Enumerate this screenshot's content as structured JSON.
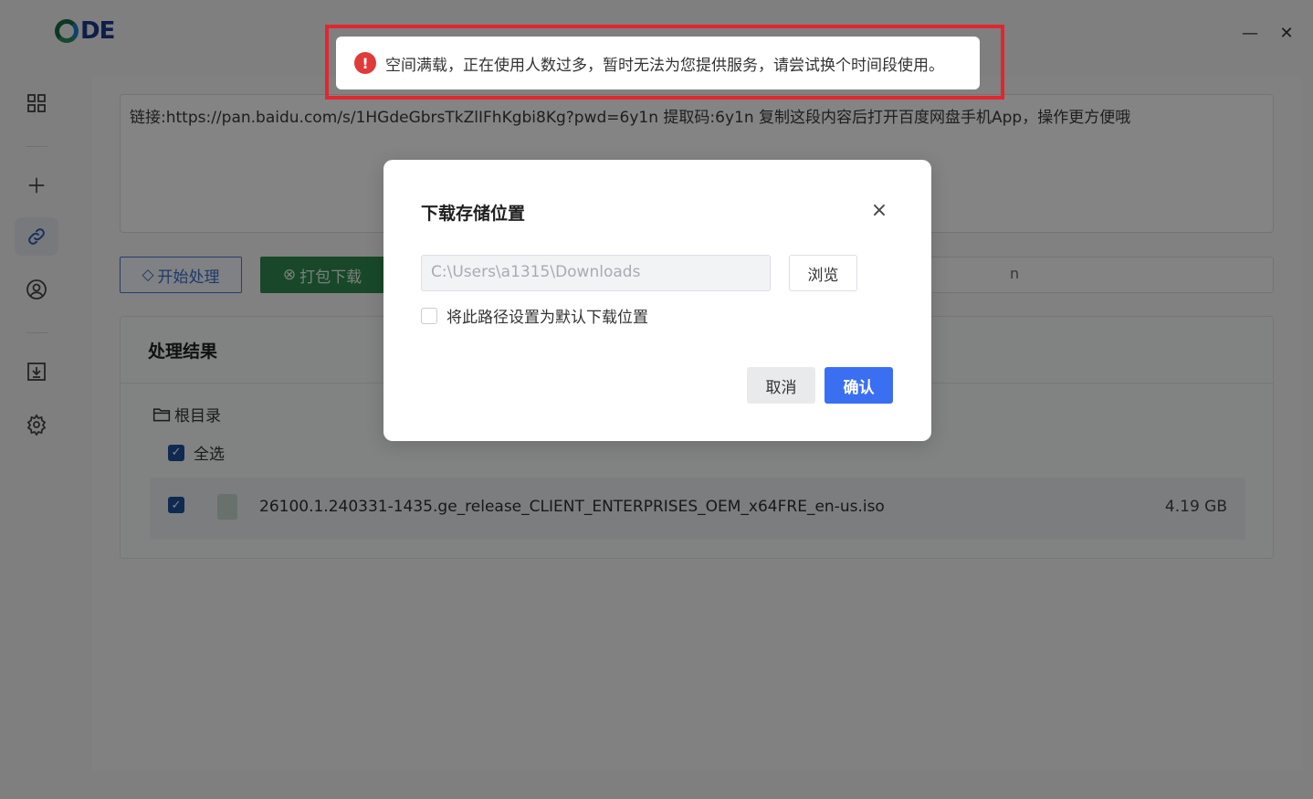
{
  "app": {
    "logo_text": "DE",
    "minimize_label": "—",
    "close_label": "✕"
  },
  "sidebar": {
    "items": [
      {
        "name": "dashboard-grid-icon",
        "active": false
      },
      {
        "name": "plus-icon",
        "active": false
      },
      {
        "name": "link-icon",
        "active": true
      },
      {
        "name": "user-icon",
        "active": false
      },
      {
        "name": "download-icon",
        "active": false
      },
      {
        "name": "gear-icon",
        "active": false
      }
    ]
  },
  "main": {
    "link_text": "链接:https://pan.baidu.com/s/1HGdeGbrsTkZlIFhKgbi8Kg?pwd=6y1n 提取码:6y1n 复制这段内容后打开百度网盘手机App，操作更方便哦",
    "start_button": "开始处理",
    "pack_button": "打包下载",
    "right_input_partial": "n",
    "result_title": "处理结果",
    "tree_root": "根目录",
    "select_all": "全选",
    "files": [
      {
        "name": "26100.1.240331-1435.ge_release_CLIENT_ENTERPRISES_OEM_x64FRE_en-us.iso",
        "size": "4.19 GB",
        "checked": true
      }
    ]
  },
  "dialog": {
    "title": "下载存储位置",
    "close_label": "×",
    "path_placeholder": "C:\\Users\\a1315\\Downloads",
    "browse_button": "浏览",
    "default_checkbox_label": "将此路径设置为默认下载位置",
    "cancel_button": "取消",
    "confirm_button": "确认"
  },
  "toast": {
    "icon": "!",
    "message": "空间满载，正在使用人数过多，暂时无法为您提供服务，请尝试换个时间段使用。"
  },
  "colors": {
    "accent": "#3b6ff2",
    "pack_green": "#2e8a4f",
    "error_red": "#e03a3a",
    "highlight_frame": "#e1262e"
  }
}
